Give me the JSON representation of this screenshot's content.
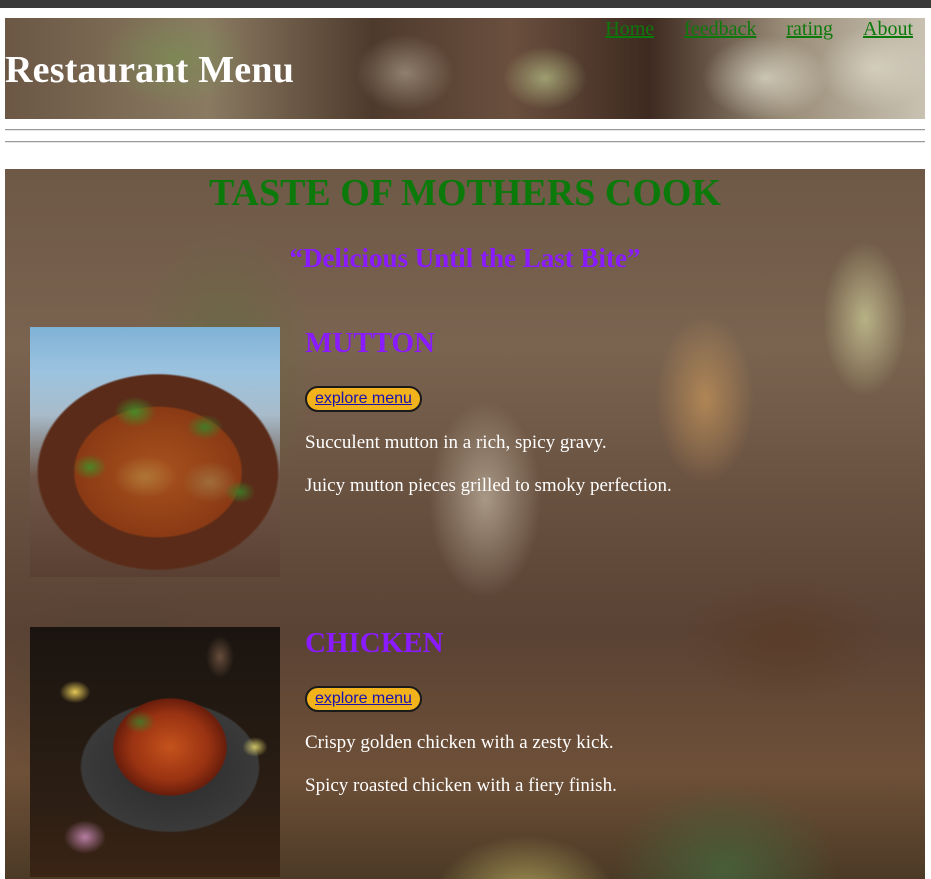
{
  "header": {
    "title": "Restaurant Menu",
    "nav": [
      "Home",
      "feedback",
      "rating",
      "About"
    ]
  },
  "hero": {
    "title": "TASTE OF MOTHERS COOK",
    "tagline": "“Delicious Until the Last Bite”"
  },
  "items": [
    {
      "title": "MUTTON",
      "button": "explore menu",
      "descriptions": [
        "Succulent mutton in a rich, spicy gravy.",
        "Juicy mutton pieces grilled to smoky perfection."
      ]
    },
    {
      "title": "CHICKEN",
      "button": "explore menu",
      "descriptions": [
        "Crispy golden chicken with a zesty kick.",
        "Spicy roasted chicken with a fiery finish."
      ]
    }
  ],
  "colors": {
    "nav_link": "#0b7a0b",
    "hero_title": "#0b7a0b",
    "accent_purple": "#8a1aff",
    "button_bg": "#f2b21b"
  }
}
